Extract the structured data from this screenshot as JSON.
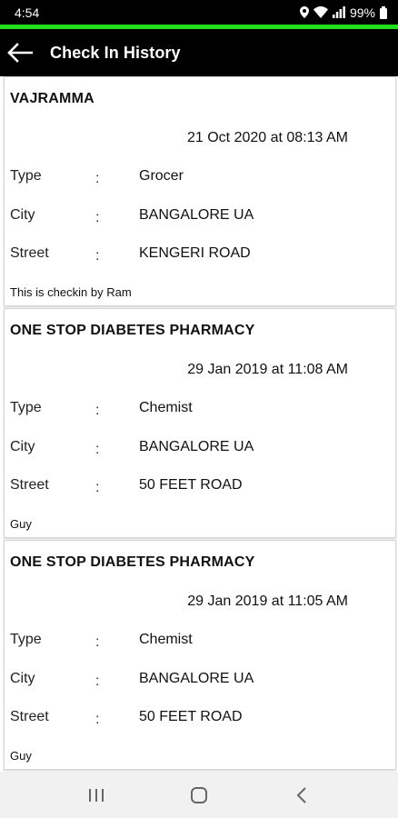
{
  "status_bar": {
    "time": "4:54",
    "battery": "99%",
    "icons": [
      "location-icon",
      "wifi-icon",
      "signal-icon",
      "battery-icon"
    ]
  },
  "app_bar": {
    "title": "Check In History",
    "back_icon": "arrow-left-icon",
    "accent_color": "#22e01d"
  },
  "checkins": [
    {
      "name": "VAJRAMMA",
      "datetime": "21 Oct 2020 at 08:13 AM",
      "fields": [
        {
          "label": "Type",
          "colon": ":",
          "value": "Grocer"
        },
        {
          "label": "City",
          "colon": ":",
          "value": "BANGALORE UA"
        },
        {
          "label": "Street",
          "colon": ":",
          "value": "KENGERI ROAD"
        }
      ],
      "note": "This is checkin by Ram"
    },
    {
      "name": "ONE STOP DIABETES PHARMACY",
      "datetime": "29 Jan 2019 at 11:08 AM",
      "fields": [
        {
          "label": "Type",
          "colon": ":",
          "value": "Chemist"
        },
        {
          "label": "City",
          "colon": ":",
          "value": "BANGALORE UA"
        },
        {
          "label": "Street",
          "colon": ":",
          "value": "50 FEET ROAD"
        }
      ],
      "note": "Guy"
    },
    {
      "name": "ONE STOP DIABETES PHARMACY",
      "datetime": "29 Jan 2019 at 11:05 AM",
      "fields": [
        {
          "label": "Type",
          "colon": ":",
          "value": "Chemist"
        },
        {
          "label": "City",
          "colon": ":",
          "value": "BANGALORE UA"
        },
        {
          "label": "Street",
          "colon": ":",
          "value": "50 FEET ROAD"
        }
      ],
      "note": "Guy"
    }
  ],
  "nav_bar": {
    "buttons": [
      "recent-apps-icon",
      "home-icon",
      "back-icon"
    ]
  }
}
